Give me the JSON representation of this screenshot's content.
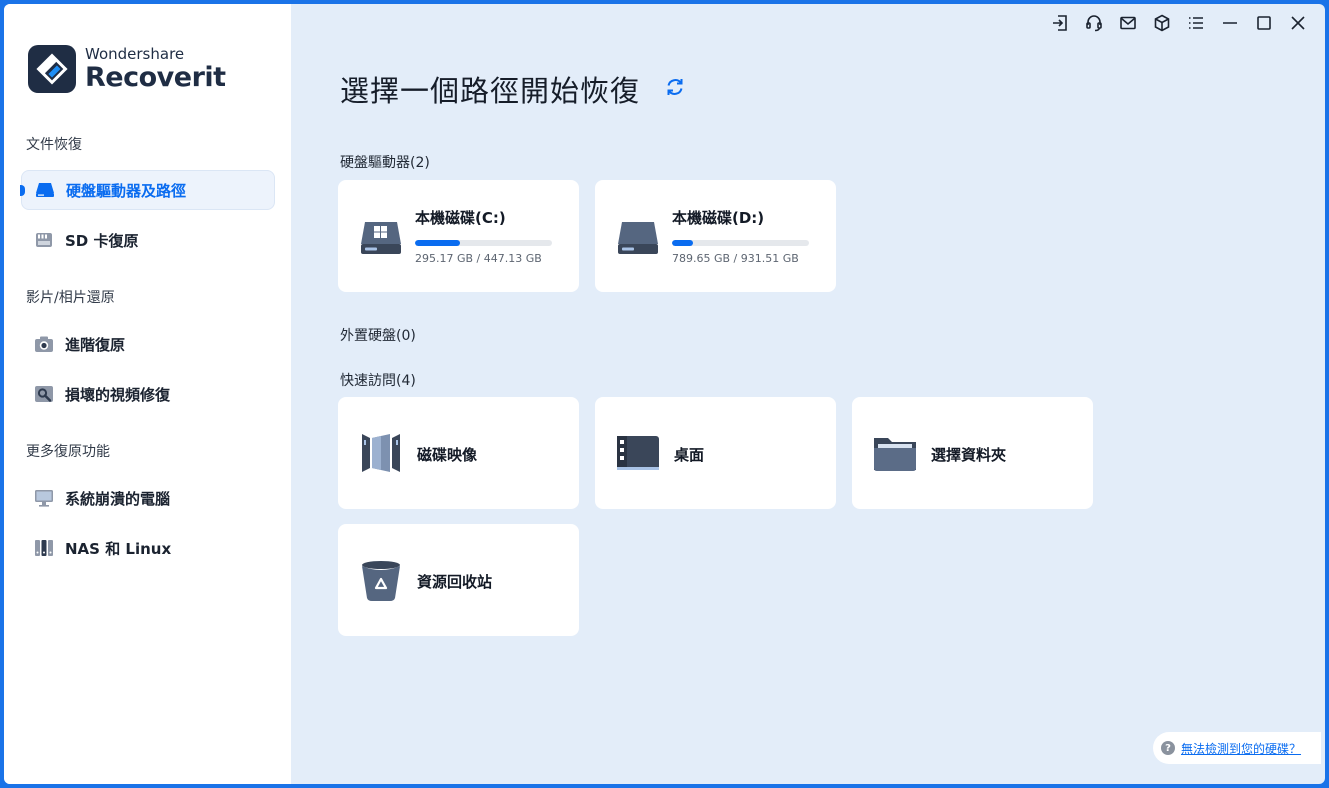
{
  "app": {
    "brand": "Wondershare",
    "product": "Recoverit"
  },
  "sidebar": {
    "sections": [
      {
        "label": "文件恢復"
      },
      {
        "label": "影片/相片還原"
      },
      {
        "label": "更多復原功能"
      }
    ],
    "items": [
      {
        "label": "硬盤驅動器及路徑",
        "icon": "hard-drive-icon",
        "active": true
      },
      {
        "label": "SD 卡復原",
        "icon": "sd-card-icon"
      },
      {
        "label": "進階復原",
        "icon": "camera-icon"
      },
      {
        "label": "損壞的視頻修復",
        "icon": "video-repair-icon"
      },
      {
        "label": "系統崩潰的電腦",
        "icon": "computer-monitor-icon"
      },
      {
        "label": "NAS 和 Linux",
        "icon": "nas-server-icon"
      }
    ]
  },
  "main": {
    "title": "選擇一個路徑開始恢復",
    "hard_drives": {
      "label": "硬盤驅動器(2)",
      "drives": [
        {
          "name": "本機磁碟(C:)",
          "size": "295.17 GB / 447.13 GB",
          "used_fraction": 0.33,
          "icon": "windows-drive-icon"
        },
        {
          "name": "本機磁碟(D:)",
          "size": "789.65 GB / 931.51 GB",
          "used_fraction": 0.15,
          "icon": "drive-icon"
        }
      ]
    },
    "external": {
      "label": "外置硬盤(0)"
    },
    "quick_access": {
      "label": "快速訪問(4)",
      "items": [
        {
          "label": "磁碟映像",
          "icon": "disk-image-icon"
        },
        {
          "label": "桌面",
          "icon": "desktop-icon"
        },
        {
          "label": "選擇資料夾",
          "icon": "folder-icon"
        },
        {
          "label": "資源回收站",
          "icon": "recycle-bin-icon"
        }
      ]
    }
  },
  "help": {
    "text": "無法檢測到您的硬碟？"
  },
  "colors": {
    "accent": "#0a6cf0",
    "background": "#e3edf9",
    "sidebar": "#ffffff",
    "text": "#131a26"
  }
}
